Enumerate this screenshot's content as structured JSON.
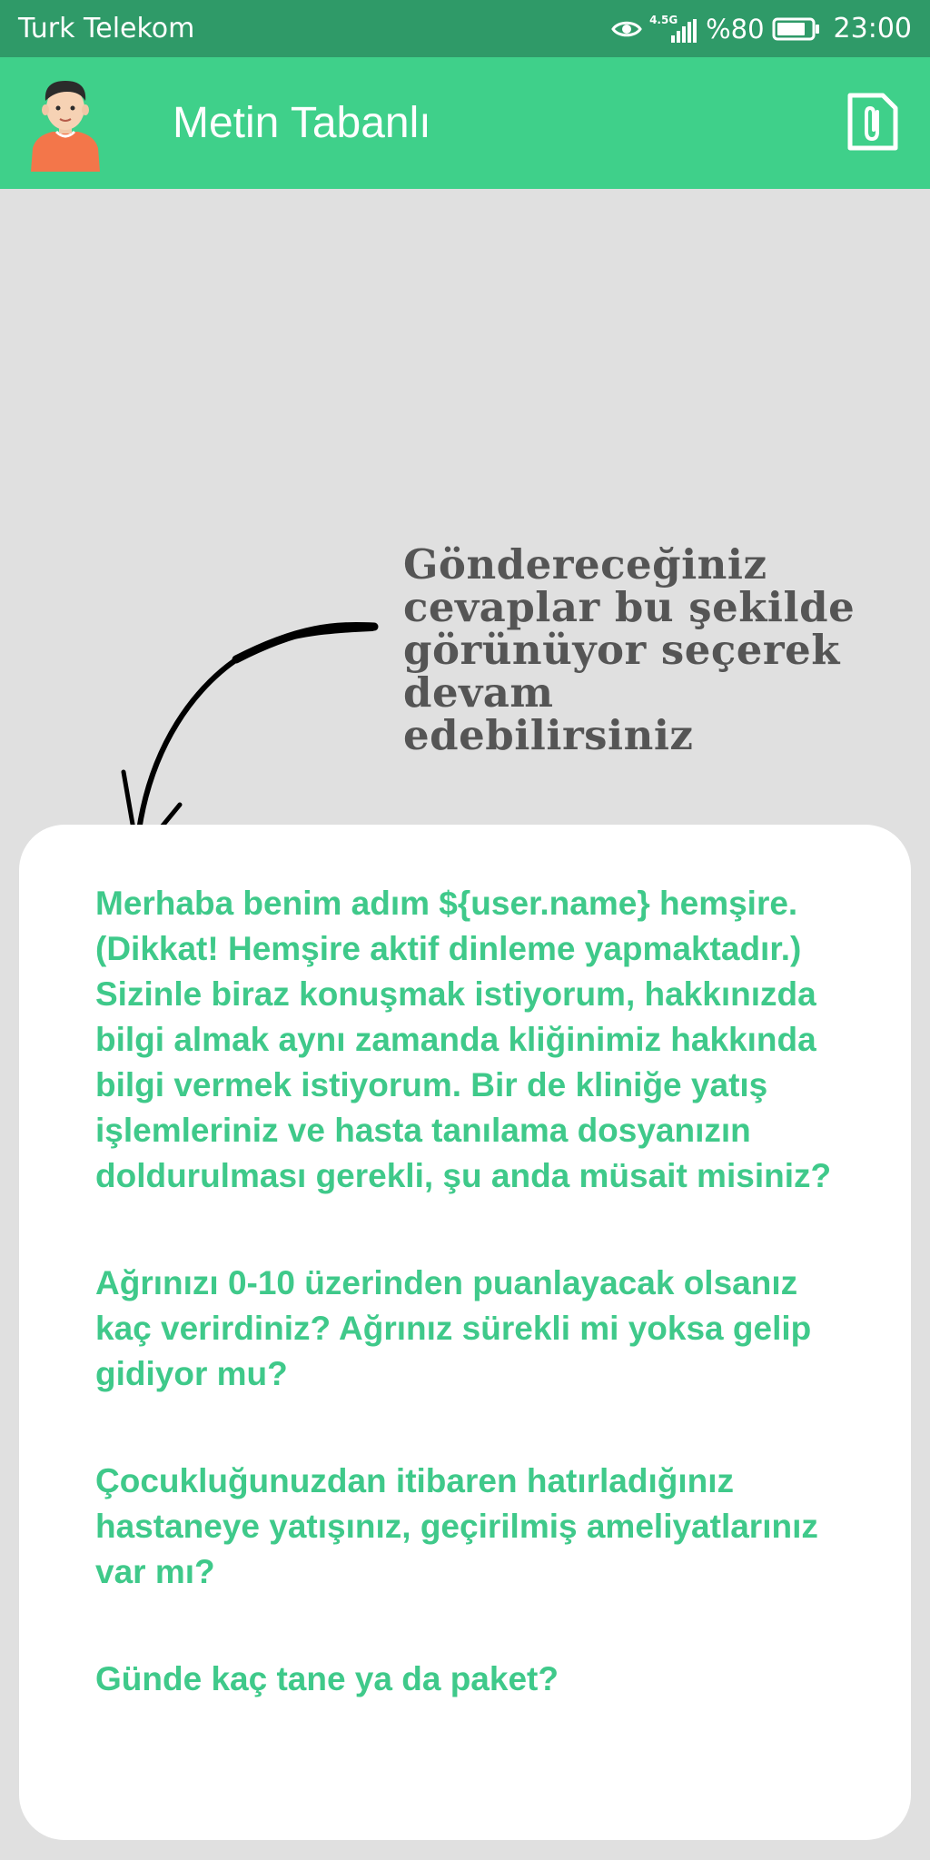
{
  "status_bar": {
    "carrier": "Turk Telekom",
    "network_label": "4.5G",
    "battery_percent": "%80",
    "time": "23:00",
    "icons": [
      "eye-icon",
      "signal-icon",
      "battery-icon"
    ]
  },
  "app_bar": {
    "title": "Metin Tabanlı",
    "avatar_icon": "avatar-icon",
    "attach_icon": "attach-icon",
    "background_color": "#3fd08a"
  },
  "hint": {
    "text": "Göndereceğiniz cevaplar bu şekilde görünüyor seçerek devam edebilirsiniz",
    "arrow_icon": "curved-arrow-icon"
  },
  "answers": [
    "Merhaba benim adım ${user.name} hemşire. (Dikkat! Hemşire aktif dinleme yapmaktadır.) Sizinle biraz konuşmak istiyorum, hakkınızda bilgi almak aynı zamanda kliğinimiz hakkında bilgi vermek istiyorum. Bir de kliniğe yatış işlemleriniz ve hasta tanılama dosyanızın doldurulması gerekli, şu anda müsait misiniz?",
    "Ağrınızı 0-10 üzerinden puanlayacak olsanız kaç verirdiniz? Ağrınız sürekli mi yoksa gelip gidiyor mu?",
    "Çocukluğunuzdan itibaren hatırladığınız hastaneye yatışınız, geçirilmiş ameliyatlarınız var mı?",
    "Günde kaç tane ya da paket?"
  ],
  "colors": {
    "status_bar": "#2f9a68",
    "accent_green": "#3fc98a",
    "background": "#e0e0e0",
    "hint_text": "#555555"
  }
}
